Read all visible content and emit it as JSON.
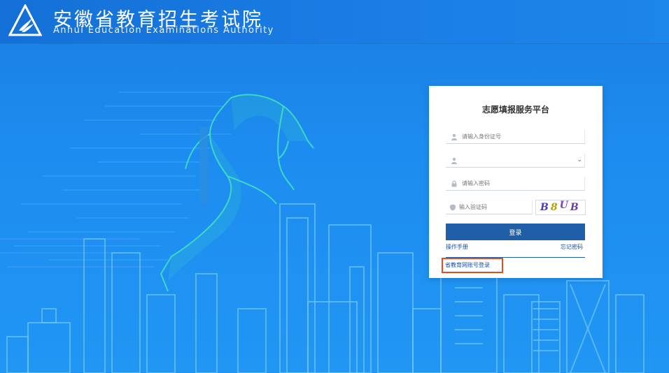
{
  "header": {
    "title_cn": "安徽省教育招生考试院",
    "title_en": "Anhui Education Examinations Authority"
  },
  "login": {
    "title": "志愿填报服务平台",
    "id_placeholder": "请输入身份证号",
    "select_value": "",
    "password_placeholder": "请输入密码",
    "captcha_placeholder": "输入验证码",
    "captcha_chars": [
      "B",
      "8",
      "U",
      "B"
    ],
    "login_button": "登录",
    "manual_link": "操作手册",
    "forgot_link": "忘记密码",
    "other_login_link": "省教育网账号登录"
  },
  "colors": {
    "background": "#1d8cf0",
    "button": "#1f5fa8",
    "highlight_border": "#e74c1f",
    "figure": "#3fe0c0"
  },
  "icons": [
    "logo-icon",
    "user-icon",
    "lock-icon",
    "shield-icon",
    "chevron-down-icon"
  ]
}
